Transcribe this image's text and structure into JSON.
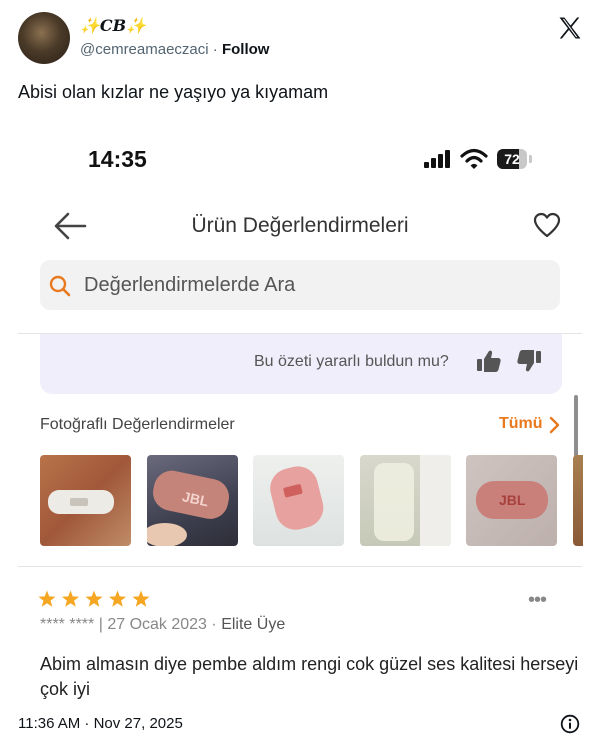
{
  "tweet": {
    "display_name": "✨CB✨",
    "handle": "@cemreamaeczaci",
    "separator": "·",
    "follow_label": "Follow",
    "text": "Abisi olan kızlar ne yaşıyo ya kıyamam",
    "timestamp": "11:36 AM · Nov 27, 2025",
    "icons": [
      "x-logo-icon",
      "info-icon"
    ]
  },
  "phone": {
    "status_bar": {
      "time": "14:35",
      "battery": "72",
      "battery_level": 0.72
    },
    "nav": {
      "title": "Ürün Değerlendirmeleri",
      "icons": [
        "back-arrow-icon",
        "heart-icon"
      ]
    },
    "search": {
      "placeholder": "Değerlendirmelerde Ara"
    },
    "summary": {
      "helpful_question": "Bu özeti yararlı buldun mu?"
    },
    "photos": {
      "label": "Fotoğraflı Değerlendirmeler",
      "all_label": "Tümü",
      "items": [
        {
          "caption": "speaker photo 1"
        },
        {
          "caption": "speaker photo 2"
        },
        {
          "caption": "speaker photo 3"
        },
        {
          "caption": "speaker photo 4"
        },
        {
          "caption": "speaker photo 5"
        },
        {
          "caption": "speaker photo 6"
        }
      ]
    },
    "review": {
      "rating": 5,
      "rating_max": 5,
      "reviewer": "**** ****",
      "meta_separator": "|",
      "date": "27 Ocak 2023",
      "dot": "·",
      "tier": "Elite Üye",
      "more": "•••",
      "text": "Abim almasın diye pembe aldım rengi  cok güzel ses kalitesi herseyi çok iyi"
    }
  },
  "colors": {
    "accent_orange": "#e8791e",
    "star": "#f5a623",
    "summary_bg": "#f1eefb",
    "search_bg": "#f2f2f2"
  }
}
